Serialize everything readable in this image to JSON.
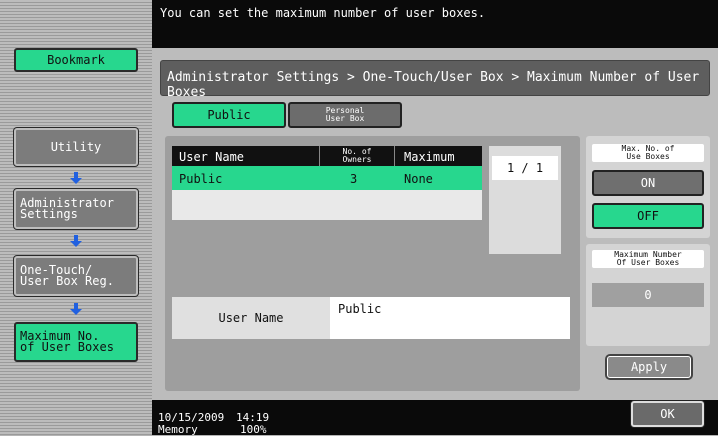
{
  "message": "You can set the maximum number of user boxes.",
  "sidebar": {
    "bookmark": "Bookmark",
    "items": [
      {
        "label": "Utility"
      },
      {
        "label": "Administrator\nSettings"
      },
      {
        "label": "One-Touch/\nUser Box Reg."
      },
      {
        "label": "Maximum No.\nof User Boxes"
      }
    ]
  },
  "breadcrumb": "Administrator Settings > One-Touch/User Box > Maximum Number of User Boxes",
  "tabs": [
    {
      "label": "Public",
      "active": true
    },
    {
      "label": "Personal\nUser Box",
      "active": false
    }
  ],
  "table": {
    "headers": {
      "user_name": "User Name",
      "owners": "No. of\nOwners",
      "maximum": "Maximum"
    },
    "rows": [
      {
        "user_name": "Public",
        "owners": "3",
        "maximum": "None"
      }
    ]
  },
  "pager": "1 /  1",
  "user_name_field": {
    "label": "User Name",
    "value": "Public"
  },
  "right_panel": {
    "max_boxes_label": "Max. No. of\nUse Boxes",
    "on_label": "ON",
    "off_label": "OFF",
    "max_number_label": "Maximum Number\nOf User Boxes",
    "max_number_value": "0",
    "apply_label": "Apply"
  },
  "status": {
    "date": "10/15/2009",
    "time": "14:19",
    "memory_label": "Memory",
    "memory_value": "100%"
  },
  "ok_label": "OK",
  "colors": {
    "accent": "#27d78e",
    "dark_bar": "#0a0a0a",
    "button_gray": "#6f6f6f"
  }
}
